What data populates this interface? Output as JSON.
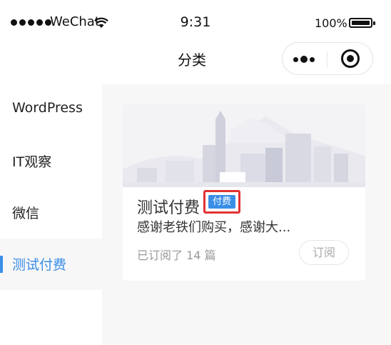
{
  "status_bar": {
    "carrier": "WeChat",
    "time": "9:31",
    "battery": "100%"
  },
  "nav": {
    "title": "分类"
  },
  "sidebar": {
    "items": [
      {
        "label": "WordPress",
        "active": false
      },
      {
        "label": "IT观察",
        "active": false
      },
      {
        "label": "微信",
        "active": false
      },
      {
        "label": "测试付费",
        "active": true
      }
    ]
  },
  "card": {
    "title": "测试付费",
    "badge": "付费",
    "description": "感谢老铁们购买，感谢大...",
    "count_text": "已订阅了 14 篇",
    "subscribe_label": "订阅"
  },
  "colors": {
    "accent": "#3a8ee6",
    "highlight_border": "#e23232",
    "content_bg": "#f7f7f8"
  }
}
